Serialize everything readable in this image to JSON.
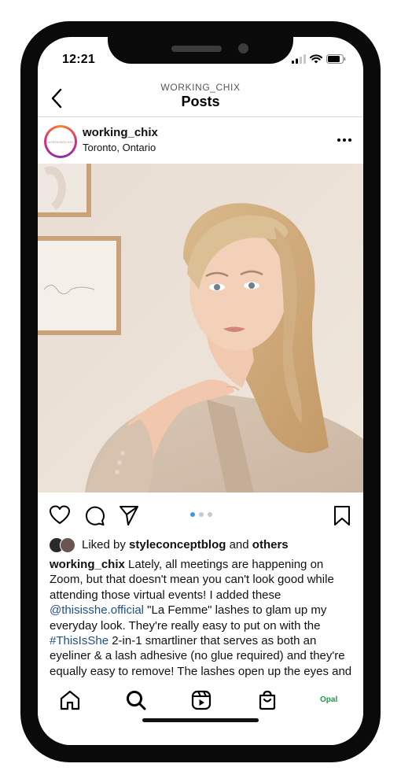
{
  "status_bar": {
    "time": "12:21"
  },
  "header": {
    "account": "WORKING_CHIX",
    "title": "Posts"
  },
  "post": {
    "username": "working_chix",
    "location": "Toronto, Ontario",
    "avatar_text": "WORKINGCHIX",
    "carousel": {
      "count": 3,
      "active_index": 0
    },
    "liked_by": {
      "prefix": "Liked by",
      "user": "styleconceptblog",
      "joiner": "and",
      "others": "others"
    },
    "caption": {
      "username": "working_chix",
      "part1": " Lately, all meetings are happening on Zoom, but that doesn't mean you can't look good while attending those virtual events! I added these ",
      "mention": "@thisisshe.official",
      "part2": " \"La Femme\" lashes to glam up my everyday look. They're really easy to put on with the ",
      "hashtag": "#ThisIsShe",
      "part3": " 2-in-1 smartliner that serves as both an eyeliner & a lash adhesive (no glue required) and they're equally easy to remove! The lashes open up the eyes and make them pop - swipe left to see what"
    }
  },
  "bottom_nav": {
    "opal_label": "Opal"
  },
  "icons": {
    "back": "chevron-left-icon",
    "more": "more-horizontal-icon",
    "like": "heart-icon",
    "comment": "comment-icon",
    "share": "send-icon",
    "save": "bookmark-icon",
    "home": "home-icon",
    "search": "search-icon",
    "reels": "reels-icon",
    "shop": "shop-bag-icon"
  },
  "colors": {
    "link": "#1f4f8c",
    "dot_active": "#3897f0",
    "opal": "#1d9a48"
  }
}
